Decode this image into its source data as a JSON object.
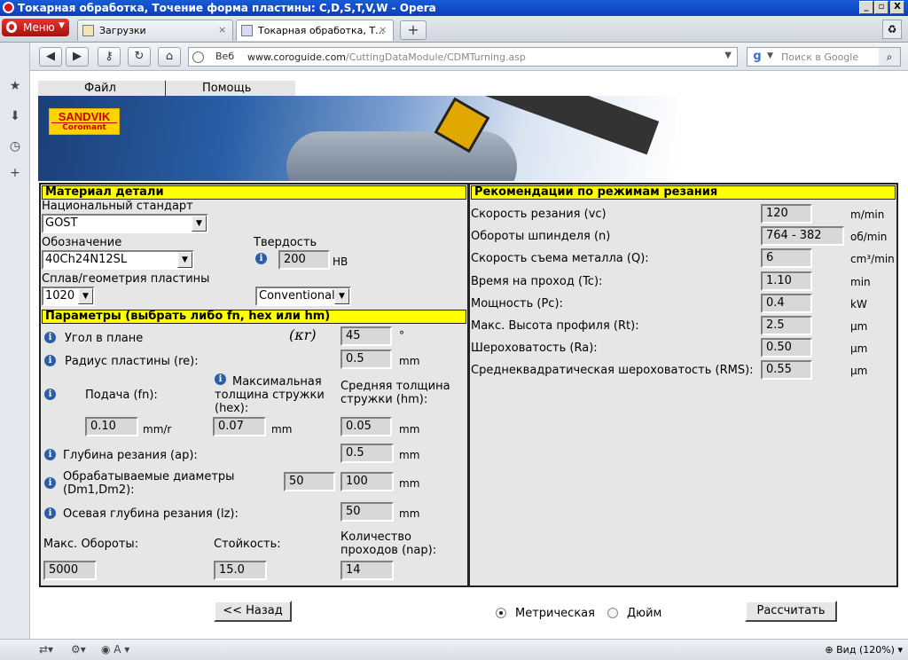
{
  "window": {
    "title": "Токарная обработка, Точение форма пластины: C,D,S,T,V,W - Opera",
    "minimize": "_",
    "maximize": "▫",
    "close": "X"
  },
  "browser": {
    "menu_label": "Меню",
    "tabs": [
      {
        "label": "Загрузки",
        "close": "×"
      },
      {
        "label": "Токарная обработка, Т...",
        "close": "×"
      }
    ],
    "new_tab": "+",
    "address": {
      "prefix": "Веб",
      "url_host": "www.coroguide.com",
      "url_path": "/CuttingDataModule/CDMTurning.asp"
    },
    "search_placeholder": "Поиск в Google",
    "zoom_label": "Вид (120%)"
  },
  "app": {
    "menu": {
      "file": "Файл",
      "help": "Помощь"
    },
    "logo": {
      "brand": "SANDVIK",
      "sub": "Coromant"
    },
    "material": {
      "header": "Материал детали",
      "standard_label": "Национальный стандарт",
      "standard_value": "GOST",
      "designation_label": "Обозначение",
      "designation_value": "40Ch24N12SL",
      "hardness_label": "Твердость",
      "hardness_value": "200",
      "hardness_unit": "HB",
      "grade_label": "Сплав/геометрия пластины",
      "grade_value": "1020",
      "geometry_value": "Conventional"
    },
    "params": {
      "header": "Параметры (выбрать либо fn, hex или hm)",
      "entering_angle_label": "Угол в плане",
      "kappa_symbol": "(κr)",
      "entering_angle_value": "45",
      "entering_angle_unit": "°",
      "radius_label": "Радиус пластины (re):",
      "radius_value": "0.5",
      "radius_unit": "mm",
      "feed_label": "Подача (fn):",
      "feed_value": "0.10",
      "feed_unit": "mm/r",
      "hex_label": "Максимальная толщина стружки (hex):",
      "hex_value": "0.07",
      "hex_unit": "mm",
      "hm_label": "Средняя толщина стружки (hm):",
      "hm_value": "0.05",
      "hm_unit": "mm",
      "depth_label": "Глубина резания (ap):",
      "depth_value": "0.5",
      "depth_unit": "mm",
      "diam_label": "Обрабатываемые диаметры (Dm1,Dm2):",
      "diam1_value": "50",
      "diam2_value": "100",
      "diam_unit": "mm",
      "axial_label": "Осевая глубина резания (lz):",
      "axial_value": "50",
      "axial_unit": "mm",
      "max_rpm_label": "Макс. Обороты:",
      "max_rpm_value": "5000",
      "tool_life_label": "Стойкость:",
      "tool_life_value": "15.0",
      "passes_label": "Количество проходов (nap):",
      "passes_value": "14"
    },
    "recs": {
      "header": "Рекомендации по режимам резания",
      "rows": [
        {
          "label": "Скорость резания (vc)",
          "value": "120",
          "unit": "m/min"
        },
        {
          "label": "Обороты шпинделя (n)",
          "value": "764 - 382",
          "unit": "об/min"
        },
        {
          "label": "Скорость съема металла (Q):",
          "value": "6",
          "unit": "cm³/min"
        },
        {
          "label": "Время на проход (Tc):",
          "value": "1.10",
          "unit": "min"
        },
        {
          "label": "Мощность (Pc):",
          "value": "0.4",
          "unit": "kW"
        },
        {
          "label": "Макс. Высота профиля (Rt):",
          "value": "2.5",
          "unit": "μm"
        },
        {
          "label": "Шероховатость (Ra):",
          "value": "0.50",
          "unit": "μm"
        },
        {
          "label": "Среднеквадратическая шероховатость (RMS):",
          "value": "0.55",
          "unit": "μm"
        }
      ]
    },
    "footer": {
      "back": "<< Назад",
      "metric": "Метрическая",
      "inch": "Дюйм",
      "calculate": "Рассчитать",
      "units_selected": "metric"
    }
  }
}
